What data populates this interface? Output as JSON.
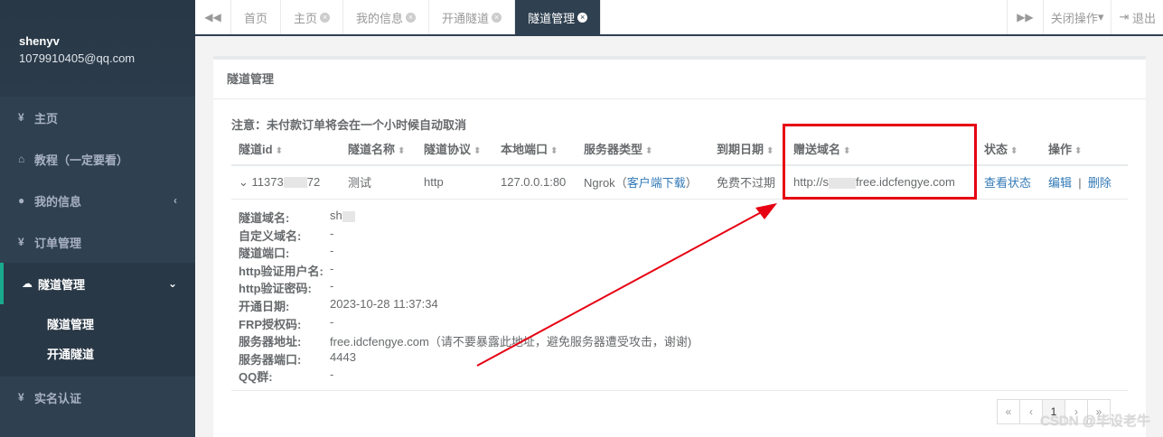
{
  "user": {
    "name": "shenyv",
    "email": "1079910405@qq.com"
  },
  "sidebar": {
    "items": [
      {
        "label": "主页"
      },
      {
        "label": "教程（一定要看）"
      },
      {
        "label": "我的信息"
      },
      {
        "label": "订单管理"
      },
      {
        "label": "隧道管理"
      },
      {
        "label": "实名认证"
      }
    ],
    "sub_items": [
      {
        "label": "隧道管理"
      },
      {
        "label": "开通隧道"
      }
    ]
  },
  "tabs": [
    {
      "label": "首页"
    },
    {
      "label": "主页"
    },
    {
      "label": "我的信息"
    },
    {
      "label": "开通隧道"
    },
    {
      "label": "隧道管理"
    }
  ],
  "toolbar": {
    "close_ops": "关闭操作",
    "logout": "退出"
  },
  "panel": {
    "title": "隧道管理",
    "notice": "注意：未付款订单将会在一个小时候自动取消"
  },
  "table": {
    "headers": [
      "隧道id",
      "隧道名称",
      "隧道协议",
      "本地端口",
      "服务器类型",
      "到期日期",
      "赠送域名",
      "状态",
      "操作"
    ],
    "row": {
      "id_prefix": "11373",
      "id_suffix": "72",
      "name": "测试",
      "protocol": "http",
      "local_port": "127.0.0.1:80",
      "server_type": "Ngrok",
      "client_download": "客户端下载",
      "expiry": "免费不过期",
      "domain_prefix": "http://s",
      "domain_suffix": "free.idcfengye.com",
      "status_link": "查看状态",
      "edit": "编辑",
      "delete": "删除"
    }
  },
  "detail": [
    {
      "label": "隧道域名:",
      "value": "sh"
    },
    {
      "label": "自定义域名:",
      "value": "-"
    },
    {
      "label": "隧道端口:",
      "value": "-"
    },
    {
      "label": "http验证用户名:",
      "value": "-"
    },
    {
      "label": "http验证密码:",
      "value": "-"
    },
    {
      "label": "开通日期:",
      "value": "2023-10-28 11:37:34"
    },
    {
      "label": "FRP授权码:",
      "value": "-"
    },
    {
      "label": "服务器地址:",
      "value": "free.idcfengye.com（请不要暴露此地址，避免服务器遭受攻击，谢谢)"
    },
    {
      "label": "服务器端口:",
      "value": "4443"
    },
    {
      "label": "QQ群:",
      "value": "-"
    }
  ],
  "pager": {
    "first": "«",
    "prev": "‹",
    "current": "1",
    "next": "›",
    "last": "»"
  },
  "watermark": "CSDN @毕设老牛",
  "colors": {
    "sidebar": "#2f4050",
    "highlight": "#e60012",
    "link": "#337ab7"
  }
}
